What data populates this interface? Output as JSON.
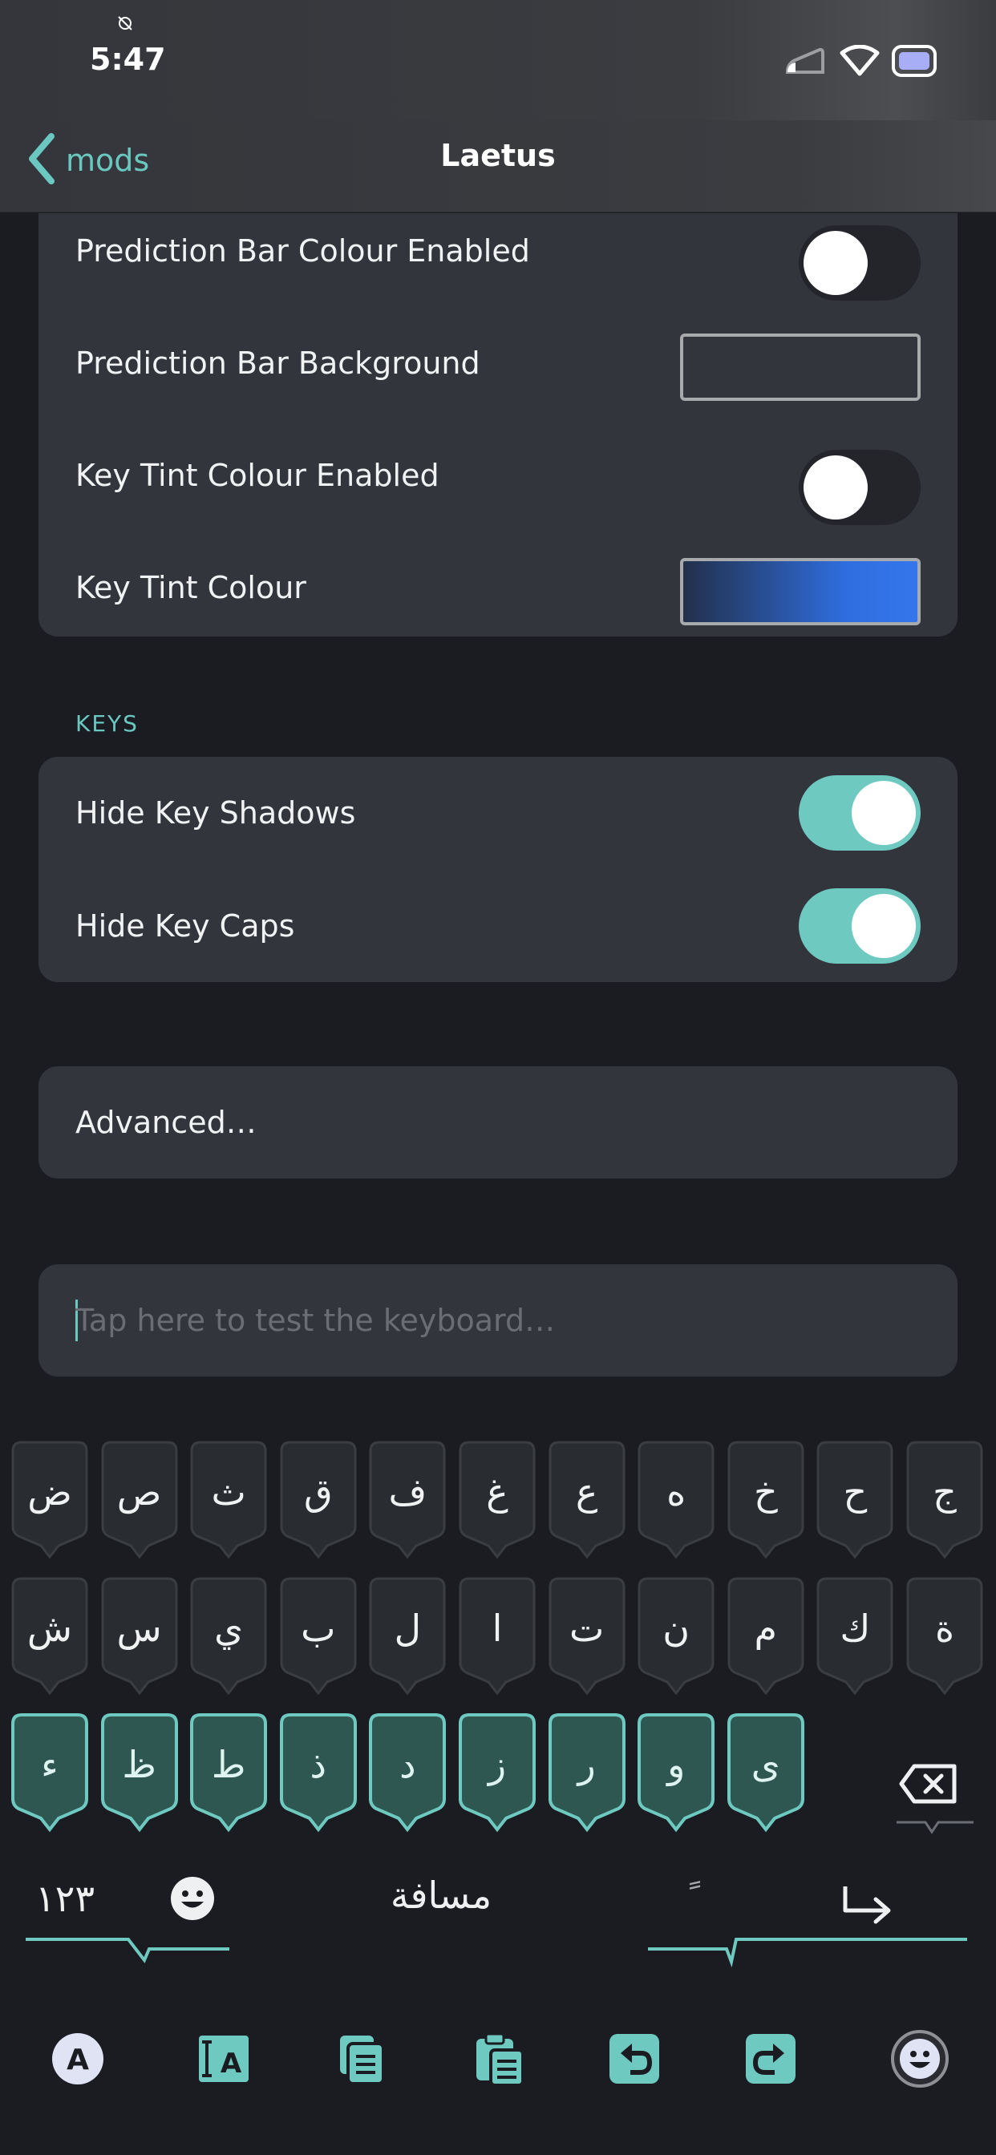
{
  "status_bar": {
    "time": "5:47"
  },
  "nav": {
    "back_label": "mods",
    "title": "Laetus"
  },
  "appearance": {
    "rows": [
      {
        "label": "Prediction Bar Colour Enabled",
        "type": "toggle",
        "on": false
      },
      {
        "label": "Prediction Bar Background",
        "type": "color",
        "color": "#33353d"
      },
      {
        "label": "Key Tint Colour Enabled",
        "type": "toggle",
        "on": false
      },
      {
        "label": "Key Tint Colour",
        "type": "color",
        "color": "#2f6ee0"
      }
    ]
  },
  "keys_section": {
    "header": "KEYS",
    "rows": [
      {
        "label": "Hide Key Shadows",
        "on": true
      },
      {
        "label": "Hide Key Caps",
        "on": true
      }
    ]
  },
  "advanced": {
    "label": "Advanced…"
  },
  "test_field": {
    "placeholder": "Tap here to test the keyboard…"
  },
  "keyboard": {
    "row1": [
      "ض",
      "ص",
      "ث",
      "ق",
      "ف",
      "غ",
      "ع",
      "ه",
      "خ",
      "ح",
      "ج"
    ],
    "row2": [
      "ش",
      "س",
      "ي",
      "ب",
      "ل",
      "ا",
      "ت",
      "ن",
      "م",
      "ك",
      "ة"
    ],
    "row3": [
      "ء",
      "ظ",
      "ط",
      "ذ",
      "د",
      "ز",
      "ر",
      "و",
      "ى"
    ],
    "numbers_label": "١٢٣",
    "space_label": "مسافة",
    "diacritic_label": "ً",
    "accent_color": "#6ec9c0"
  },
  "toolbar": {
    "icons": [
      "autocorrect-icon",
      "text-format-icon",
      "copy-icon",
      "paste-icon",
      "undo-icon",
      "redo-icon",
      "emoji-icon"
    ]
  }
}
